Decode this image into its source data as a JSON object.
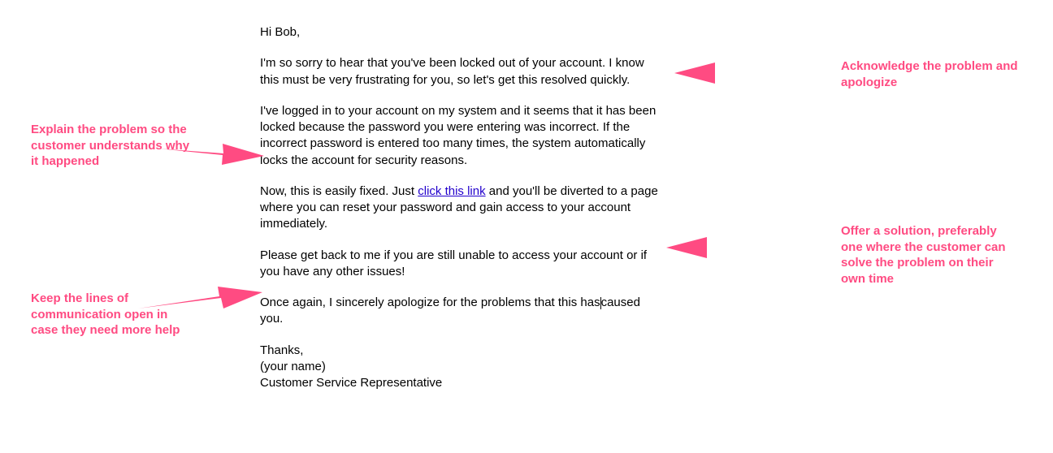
{
  "email": {
    "greeting": "Hi Bob,",
    "para1": "I'm so sorry to hear that you've been locked out of your account. I know this must be very frustrating for you, so let's get this resolved quickly.",
    "para2": "I've logged in to your account on my system and it seems that it has been locked because the password you were entering was incorrect. If the incorrect password is entered too many times, the system automatically locks the account for security reasons.",
    "para3_before_link": "Now, this is easily fixed. Just ",
    "link_text": "click this link",
    "para3_after_link": " and you'll be diverted to a page where you can reset your password and gain access to your account immediately.",
    "para4": "Please get back to me if you are still unable to access your account or if you have any other issues!",
    "para5_before_cursor": "Once again, I sincerely apologize for the problems that this has",
    "para5_after_cursor": "caused you.",
    "sign_thanks": "Thanks,",
    "sign_name": "(your name)",
    "sign_title": "Customer Service Representative"
  },
  "annotations": {
    "acknowledge": "Acknowledge the problem and apologize",
    "explain": "Explain the problem so the customer understands why it happened",
    "solution": "Offer a solution, preferably one where the customer can solve the problem on their own time",
    "communication": "Keep the lines of communication open in case they need more help"
  }
}
